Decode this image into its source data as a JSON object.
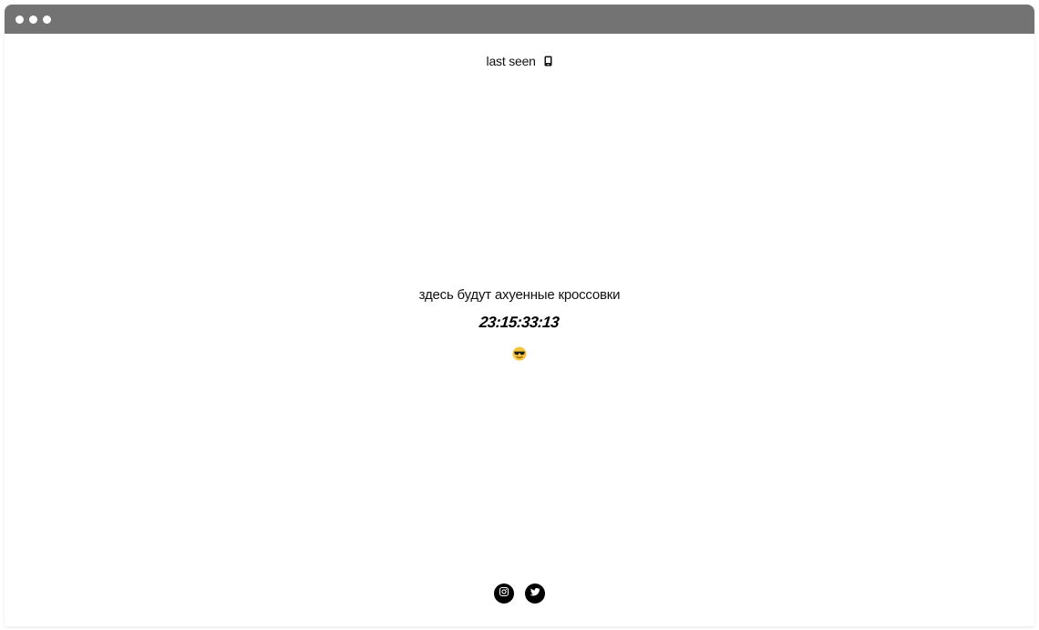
{
  "header": {
    "last_seen_label": "last seen",
    "device_icon": "mobile-phone-icon"
  },
  "main": {
    "tagline": "здесь будут ахуенные кроссовки",
    "countdown": "23:15:33:13",
    "emoji_icon": "smiling-face-with-sunglasses-icon"
  },
  "footer": {
    "socials": [
      {
        "name": "instagram-icon"
      },
      {
        "name": "twitter-icon"
      }
    ]
  },
  "colors": {
    "titlebar": "#737373",
    "text": "#111111",
    "icon_bg": "#000000"
  }
}
